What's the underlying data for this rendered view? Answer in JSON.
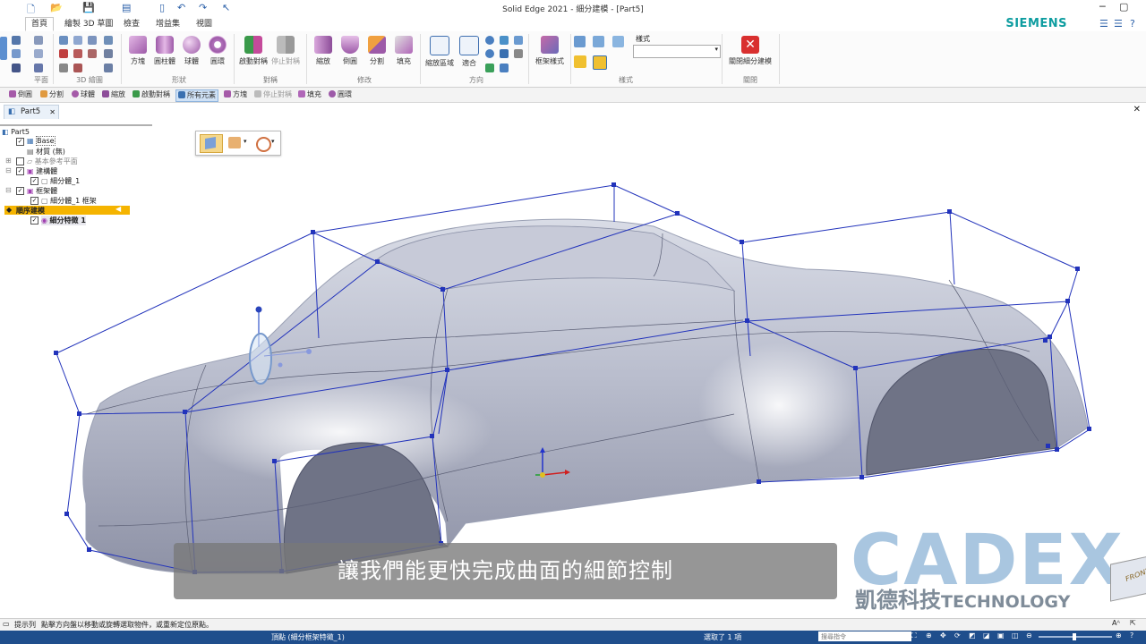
{
  "app": {
    "title": "Solid Edge 2021 - 細分建模 - [Part5]",
    "brand": "SIEMENS"
  },
  "tabs": [
    "首頁",
    "繪製 3D 草圖",
    "檢查",
    "增益集",
    "視圖"
  ],
  "ribbon": {
    "groups": {
      "plane": "平面",
      "sketch3d": "3D 繪圖",
      "shape": "形狀",
      "symmetry": "對稱",
      "modify": "修改",
      "orient": "方向",
      "style": "樣式",
      "close": "關閉"
    },
    "shape_buttons": [
      "方塊",
      "圓柱體",
      "球體",
      "圓環"
    ],
    "symmetry_buttons": [
      "啟動對稱",
      "停止對稱"
    ],
    "modify_buttons": [
      "縮放",
      "倒圓",
      "分割",
      "填充"
    ],
    "orient_buttons": [
      "縮放區域",
      "適合"
    ],
    "frame_style": "框架樣式",
    "style_label": "樣式",
    "close_button": "關閉細分建模"
  },
  "command_bar": [
    "倒圓",
    "分割",
    "球體",
    "縮放",
    "啟動對稱",
    "所有元素",
    "方塊",
    "停止對稱",
    "填充",
    "圓環"
  ],
  "document_tab": "Part5",
  "tree": [
    {
      "label": "Part5",
      "level": 0
    },
    {
      "label": "Base",
      "level": 1
    },
    {
      "label": "材質 (無)",
      "level": 2
    },
    {
      "label": "基本參考平面",
      "level": 1
    },
    {
      "label": "建構體",
      "level": 1
    },
    {
      "label": "細分體_1",
      "level": 2
    },
    {
      "label": "框架體",
      "level": 1
    },
    {
      "label": "細分體_1 框架",
      "level": 2
    },
    {
      "label": "順序建模",
      "level": 0
    },
    {
      "label": "細分特徵 1",
      "level": 2
    }
  ],
  "subtitle": "讓我們能更快完成曲面的細節控制",
  "watermark": {
    "logo": "CADEX",
    "company": "凱德科技",
    "technology": "TECHNOLOGY",
    "cube_face": "FRONT"
  },
  "status": {
    "prompt_label": "提示列",
    "prompt_text": "點擊方向盤以移動或旋轉選取物件，或重新定位原點。",
    "selected_item": "頂點 (細分框架特徵_1)",
    "selection_count": "選取了 1 項",
    "search_placeholder": "搜尋指令"
  },
  "colors": {
    "accent": "#1f4e8c",
    "cage": "#2233bb",
    "body": "#c8ccd8",
    "subtitle_bg": "#7a7a7a",
    "watermark": "#a9c6e0"
  }
}
